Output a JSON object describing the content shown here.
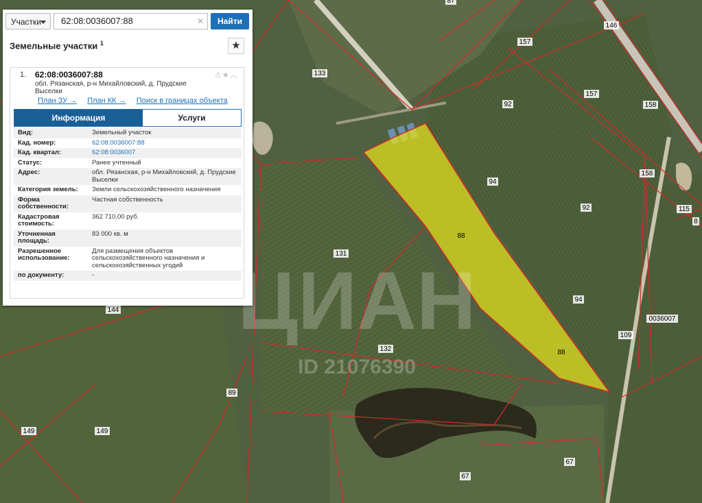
{
  "search": {
    "type_label": "Участки",
    "query": "62:08:0036007:88",
    "find_label": "Найти"
  },
  "panel": {
    "title": "Земельные участки",
    "title_count": "1"
  },
  "result": {
    "index": "1.",
    "cad_number": "62:08:0036007:88",
    "address": "обл. Рязанская, р-н Михайловский, д. Прудские Выселки",
    "links": [
      "План ЗУ →",
      "План КК →",
      "Поиск в границах объекта →"
    ],
    "tabs": [
      "Информация",
      "Услуги"
    ],
    "properties": [
      {
        "key": "Вид:",
        "value": "Земельный участок"
      },
      {
        "key": "Кад. номер:",
        "value": "62:08:0036007:88"
      },
      {
        "key": "Кад. квартал:",
        "value": "62:08:0036007"
      },
      {
        "key": "Статус:",
        "value": "Ранее учтенный"
      },
      {
        "key": "Адрес:",
        "value": "обл. Рязанская, р-н Михайловский, д. Прудские Выселки"
      },
      {
        "key": "Категория земель:",
        "value": "Земли сельскохозяйственного назначения"
      },
      {
        "key": "Форма собственности:",
        "value": "Частная собственность"
      },
      {
        "key": "Кадастровая стоимость:",
        "value": "362 710,00 руб."
      },
      {
        "key": "Уточненная площадь:",
        "value": "83 000 кв. м"
      },
      {
        "key": "Разрешенное использование:",
        "value": "Для размещения объектов сельскохозяйственного назначения и сельскохозяйственных угодий"
      },
      {
        "key": "по документу:",
        "value": "-"
      }
    ]
  },
  "map": {
    "parcel_labels": [
      "87",
      "133",
      "149",
      "157",
      "157",
      "146",
      "92",
      "158",
      "94",
      "158",
      "92",
      "115",
      "8",
      "88",
      "131",
      "94",
      "0036007",
      "144",
      "132",
      "88",
      "109",
      "89",
      "149",
      "67",
      "67"
    ],
    "watermark": "ЦИАН",
    "watermark_id": "ID 21076390",
    "highlight_color": "#e6e21a",
    "boundary_color": "#d42a2a"
  }
}
